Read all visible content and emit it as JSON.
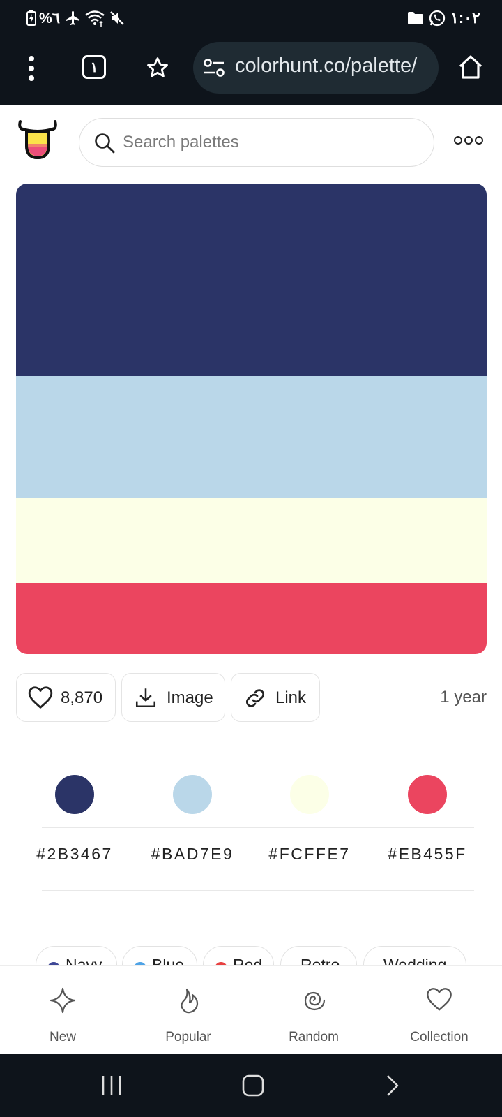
{
  "status_bar": {
    "battery_text": "%٦",
    "time": "١:٠٢"
  },
  "browser": {
    "tab_count": "١",
    "url": "colorhunt.co/palette/",
    "icons": [
      "menu-dots-icon",
      "tab-switcher-icon",
      "star-icon",
      "site-settings-icon",
      "home-icon"
    ]
  },
  "site": {
    "logo": "colorhunt-logo",
    "search_placeholder": "Search palettes",
    "more_label": "ooo"
  },
  "palette": {
    "colors": [
      "#2B3467",
      "#BAD7E9",
      "#FCFFE7",
      "#EB455F"
    ],
    "hex_labels": [
      "#2B3467",
      "#BAD7E9",
      "#FCFFE7",
      "#EB455F"
    ]
  },
  "actions": {
    "likes": "8,870",
    "image_label": "Image",
    "link_label": "Link",
    "age": "1 year"
  },
  "tags": [
    {
      "label": "Navy",
      "color": "#3f4796"
    },
    {
      "label": "Blue",
      "color": "#4fa3e6"
    },
    {
      "label": "Red",
      "color": "#e84141"
    },
    {
      "label": "Retro",
      "color": ""
    },
    {
      "label": "Wedding",
      "color": ""
    }
  ],
  "bottom_nav": {
    "items": [
      {
        "label": "New",
        "icon": "sparkle-icon"
      },
      {
        "label": "Popular",
        "icon": "flame-icon"
      },
      {
        "label": "Random",
        "icon": "spiral-icon"
      },
      {
        "label": "Collection",
        "icon": "heart-icon"
      }
    ]
  },
  "system_nav": {
    "icons": [
      "recents-icon",
      "home-icon",
      "back-icon"
    ]
  }
}
